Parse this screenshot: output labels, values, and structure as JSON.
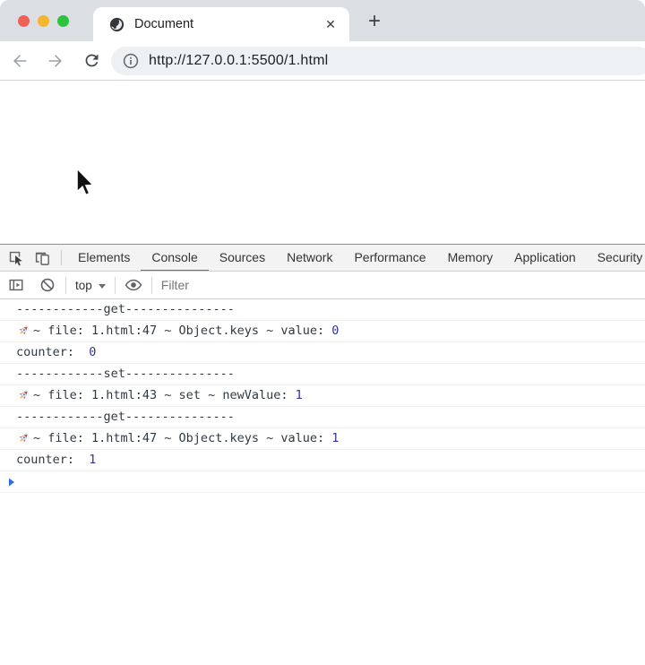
{
  "window": {
    "traffic_lights": [
      {
        "name": "close",
        "color": "#ee6156"
      },
      {
        "name": "minimize",
        "color": "#f5b62d"
      },
      {
        "name": "zoom",
        "color": "#2dc43b"
      }
    ]
  },
  "tab_strip": {
    "tab": {
      "title": "Document",
      "favicon": "globe-icon",
      "close_glyph": "✕"
    },
    "new_tab_glyph": "+"
  },
  "toolbar": {
    "back_icon": "arrow-left-icon",
    "forward_icon": "arrow-right-icon",
    "refresh_icon": "reload-icon",
    "info_icon": "info-icon",
    "url": "http://127.0.0.1:5500/1.html"
  },
  "page": {
    "cursor_icon": "mouse-pointer-icon"
  },
  "devtools": {
    "tabs": [
      {
        "label": "Elements"
      },
      {
        "label": "Console"
      },
      {
        "label": "Sources"
      },
      {
        "label": "Network"
      },
      {
        "label": "Performance"
      },
      {
        "label": "Memory"
      },
      {
        "label": "Application"
      },
      {
        "label": "Security"
      }
    ],
    "active_tab": "Console",
    "icons": {
      "inspect": "inspect-element-icon",
      "device": "device-toolbar-icon",
      "sidebar": "console-sidebar-icon",
      "clear": "clear-console-icon",
      "eye": "live-expression-eye-icon"
    },
    "console_toolbar": {
      "context_selector": "top",
      "filter_placeholder": "Filter"
    },
    "messages": [
      {
        "kind": "plain",
        "text": "------------get---------------"
      },
      {
        "kind": "rocket",
        "icon": "rocket-icon",
        "text": "~ file: 1.html:47 ~ Object.keys ~ value: ",
        "value": "0"
      },
      {
        "kind": "plain",
        "text": "counter:  ",
        "value": "0"
      },
      {
        "kind": "plain",
        "text": "------------set---------------"
      },
      {
        "kind": "rocket",
        "icon": "rocket-icon",
        "text": "~ file: 1.html:43 ~ set ~ newValue: ",
        "value": "1"
      },
      {
        "kind": "plain",
        "text": "------------get---------------"
      },
      {
        "kind": "rocket",
        "icon": "rocket-icon",
        "text": "~ file: 1.html:47 ~ Object.keys ~ value: ",
        "value": "1"
      },
      {
        "kind": "plain",
        "text": "counter:  ",
        "value": "1"
      }
    ],
    "prompt_icon": "chevron-right-icon"
  },
  "colors": {
    "accent_blue": "#3b78e7",
    "number_blue": "#31339c",
    "prompt_blue": "#2d6be0",
    "tabstrip_bg": "#dbdfe4",
    "devtools_tabbar_bg": "#f3f3f3",
    "urlbar_bg": "#eef1f3"
  }
}
